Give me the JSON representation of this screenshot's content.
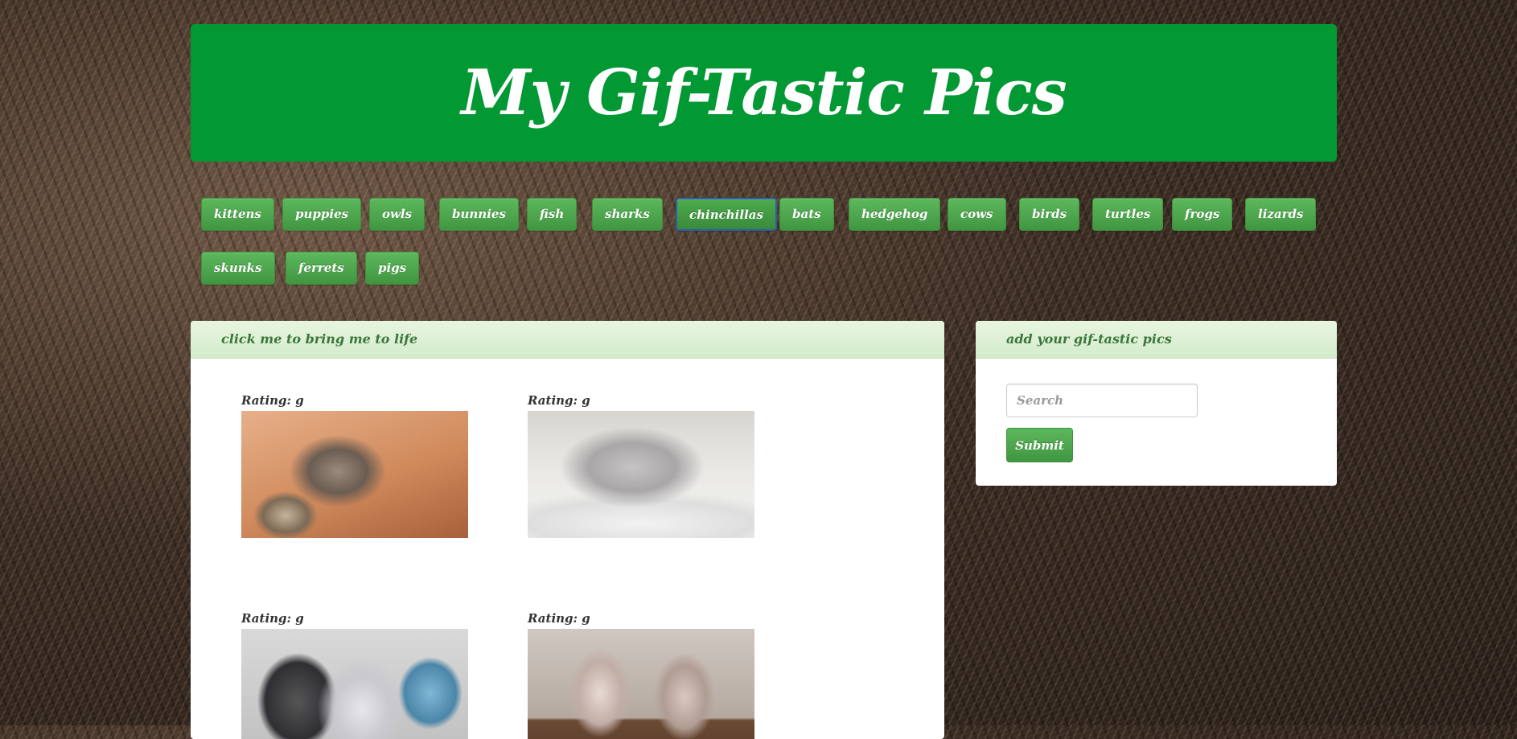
{
  "header": {
    "title": "My Gif-Tastic Pics"
  },
  "topics": [
    "kittens",
    "puppies",
    "owls",
    "bunnies",
    "fish",
    "sharks",
    "chinchillas",
    "bats",
    "hedgehog",
    "cows",
    "birds",
    "turtles",
    "frogs",
    "lizards",
    "skunks",
    "ferrets",
    "pigs"
  ],
  "active_topic": "chinchillas",
  "gif_panel": {
    "heading": "click me to bring me to life",
    "items": [
      {
        "rating": "Rating: g"
      },
      {
        "rating": "Rating: g"
      },
      {
        "rating": "Rating: g"
      },
      {
        "rating": "Rating: g"
      }
    ]
  },
  "add_panel": {
    "heading": "add your gif-tastic pics",
    "search_placeholder": "Search",
    "submit_label": "Submit"
  },
  "colors": {
    "header_green": "#029834",
    "button_green": "#5cb85c",
    "panel_heading_bg": "#dff0d8",
    "panel_heading_text": "#3c763d",
    "active_border": "#2d5fa8"
  }
}
